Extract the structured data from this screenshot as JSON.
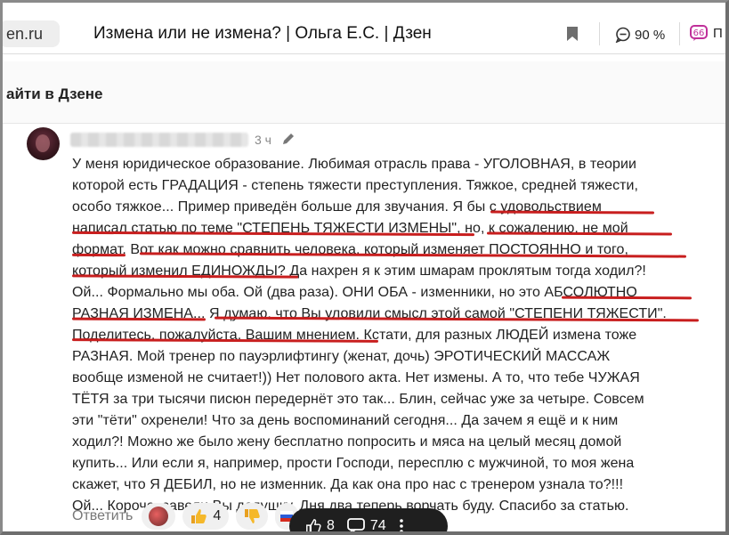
{
  "browser": {
    "url_domain": "en.ru",
    "page_title": "Измена или не измена? | Ольга Е.С. | Дзен",
    "zoom": "90 %",
    "extension_label": "П"
  },
  "banner": {
    "text": "айти в Дзене"
  },
  "comment": {
    "time": "3 ч",
    "lines": [
      "У меня юридическое образование. Любимая отрасль права - УГОЛОВНАЯ, в теории",
      "которой есть ГРАДАЦИЯ - степень тяжести преступления. Тяжкое, средней тяжести,",
      "особо тяжкое... Пример приведён больше для звучания. Я бы с удовольствием",
      "написал статью по теме \"СТЕПЕНЬ ТЯЖЕСТИ ИЗМЕНЫ\", но, к сожалению, не мой",
      "формат. Вот как можно сравнить человека, который изменяет ПОСТОЯННО и того,",
      "который изменил ЕДИНОЖДЫ? Да нахрен я к этим шмарам проклятым тогда ходил?!",
      "Ой... Формально мы оба. Ой (два раза). ОНИ ОБА - изменники, но это АБСОЛЮТНО",
      "РАЗНАЯ ИЗМЕНА... Я думаю, что Вы уловили смысл этой самой \"СТЕПЕНИ ТЯЖЕСТИ\".",
      "Поделитесь, пожалуйста, Вашим мнением. Кстати, для разных ЛЮДЕЙ измена тоже",
      "РАЗНАЯ. Мой тренер по пауэрлифтингу (женат, дочь) ЭРОТИЧЕСКИЙ МАССАЖ",
      "вообще изменой не считает!)) Нет полового акта. Нет измены. А то, что тебе ЧУЖАЯ",
      "ТЁТЯ за три тысячи писюн передернёт это так... Блин, сейчас уже за четыре. Совсем",
      "эти \"тёти\" охренели! Что за день воспоминаний сегодня... Да зачем я ещё и к ним",
      "ходил?! Можно же было жену бесплатно попросить и мяса на целый месяц домой",
      "купить... Или если я, например, прости Господи, пересплю с мужчиной, то моя жена",
      "скажет, что Я ДЕБИЛ, но не изменник. Да как она про нас с тренером узнала то?!!!",
      "Ой... Короче, завели Вы дедушку. Дня два теперь ворчать буду. Спасибо за статью."
    ],
    "underline_color": "#c81e1e"
  },
  "actions": {
    "reply_label": "Ответить",
    "like_count": "4"
  },
  "floating_bar": {
    "likes": "8",
    "comments": "74"
  }
}
